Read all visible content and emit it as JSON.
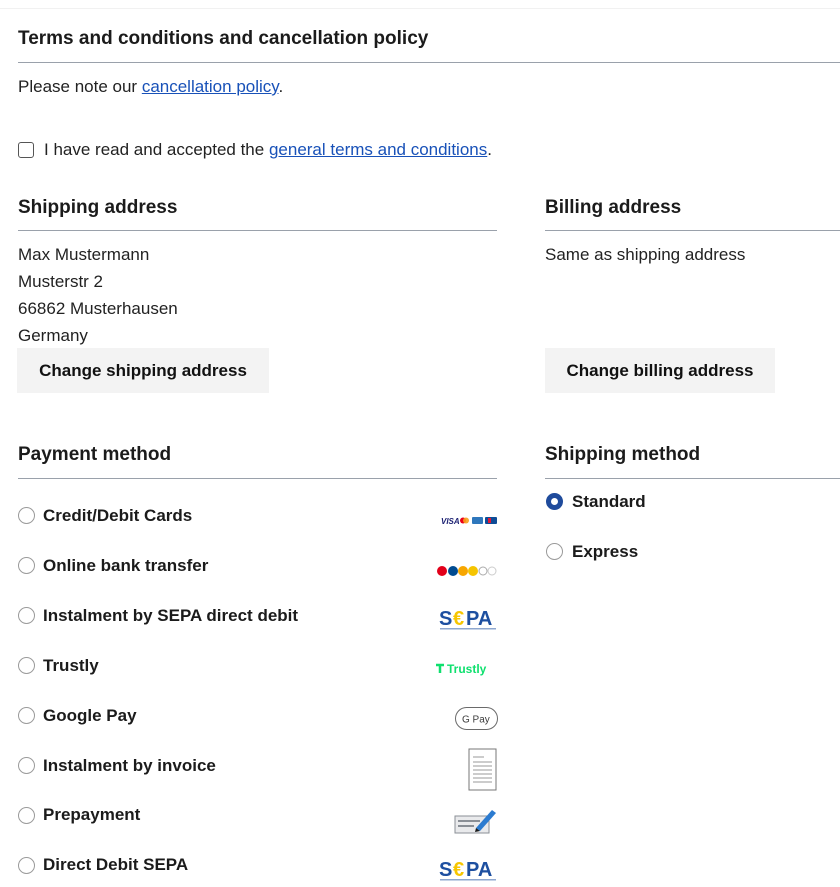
{
  "terms": {
    "title": "Terms and conditions and cancellation policy",
    "note_prefix": "Please note our ",
    "note_link": "cancellation policy",
    "note_suffix": ".",
    "accept_prefix": "I have read and accepted the ",
    "accept_link": "general terms and conditions",
    "accept_suffix": ".",
    "accepted": false
  },
  "shipping_address": {
    "title": "Shipping address",
    "lines": [
      "Max Mustermann",
      "Musterstr 2",
      "66862 Musterhausen",
      "Germany"
    ],
    "change_button": "Change shipping address"
  },
  "billing_address": {
    "title": "Billing address",
    "text": "Same as shipping address",
    "change_button": "Change billing address"
  },
  "payment_method": {
    "title": "Payment method",
    "options": [
      {
        "label": "Credit/Debit Cards",
        "logo": "card-brands-logo"
      },
      {
        "label": "Online bank transfer",
        "logo": "bank-transfer-logo"
      },
      {
        "label": "Instalment by SEPA direct debit",
        "logo": "sepa-logo"
      },
      {
        "label": "Trustly",
        "logo": "trustly-logo"
      },
      {
        "label": "Google Pay",
        "logo": "google-pay-logo"
      },
      {
        "label": "Instalment by invoice",
        "logo": "invoice-document-icon"
      },
      {
        "label": "Prepayment",
        "logo": "prepayment-icon"
      },
      {
        "label": "Direct Debit SEPA",
        "logo": "sepa-logo"
      }
    ],
    "logo_text": {
      "visa": "VISA",
      "sepa_s": "S",
      "sepa_e": "€",
      "sepa_pa": "PA",
      "trustly": "Trustly",
      "gpay": "G Pay"
    }
  },
  "shipping_method": {
    "title": "Shipping method",
    "options": [
      {
        "label": "Standard",
        "selected": true
      },
      {
        "label": "Express",
        "selected": false
      }
    ]
  },
  "colors": {
    "link": "#1851b8",
    "radio_selected": "#1f4b9c",
    "button_bg": "#f3f3f3",
    "rule": "#9aa1ab",
    "trustly_green": "#0ee06e",
    "sepa_blue": "#1d4fa0",
    "sepa_yellow": "#f7c600"
  }
}
